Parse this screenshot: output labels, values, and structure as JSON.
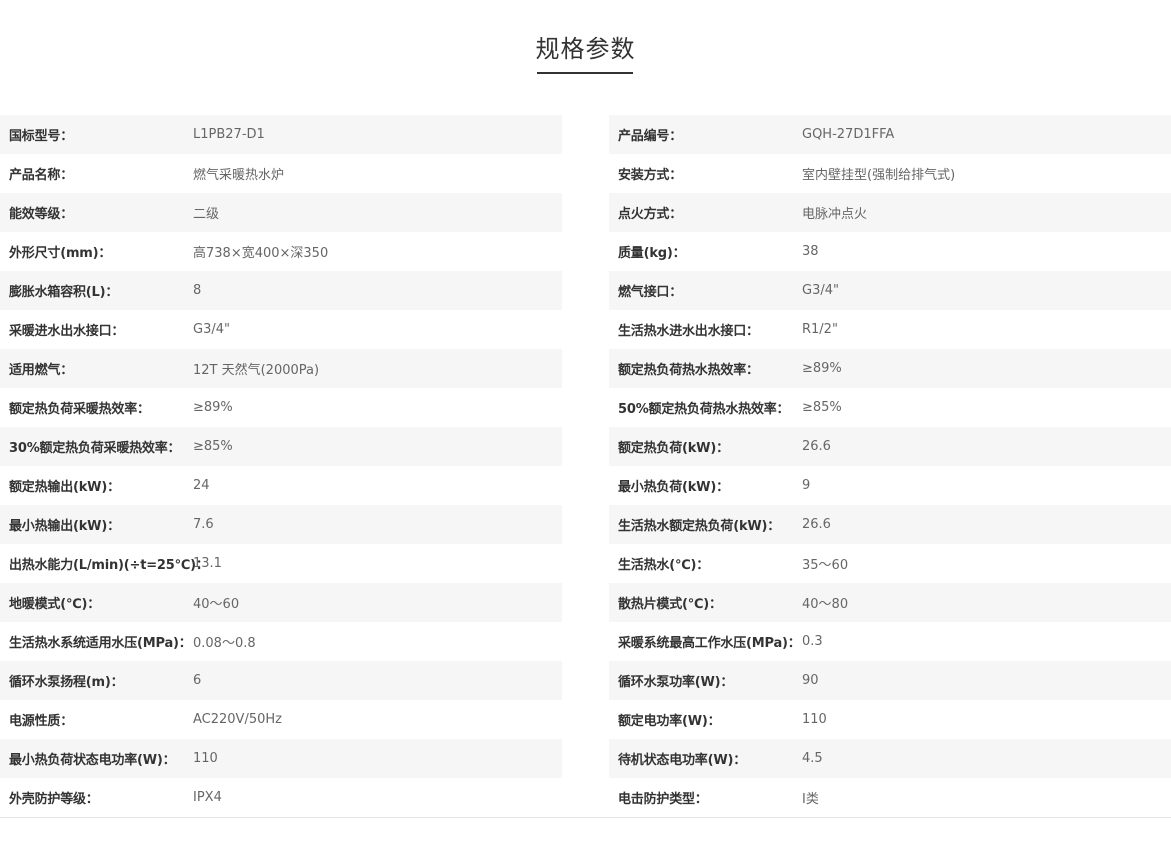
{
  "title": "规格参数",
  "left": [
    {
      "label": "国标型号：",
      "value": "L1PB27-D1"
    },
    {
      "label": "产品名称：",
      "value": "燃气采暖热水炉"
    },
    {
      "label": "能效等级：",
      "value": "二级"
    },
    {
      "label": "外形尺寸(mm)：",
      "value": "高738×宽400×深350"
    },
    {
      "label": "膨胀水箱容积(L)：",
      "value": "8"
    },
    {
      "label": "采暖进水出水接口：",
      "value": "G3/4\""
    },
    {
      "label": "适用燃气：",
      "value": "12T 天然气(2000Pa)"
    },
    {
      "label": "额定热负荷采暖热效率：",
      "value": "≥89%"
    },
    {
      "label": "30%额定热负荷采暖热效率：",
      "value": "≥85%"
    },
    {
      "label": "额定热输出(kW)：",
      "value": "24"
    },
    {
      "label": "最小热输出(kW)：",
      "value": "7.6"
    },
    {
      "label": "出热水能力(L/min)(÷t=25℃)：",
      "value": "13.1"
    },
    {
      "label": "地暖模式(℃)：",
      "value": "40～60"
    },
    {
      "label": "生活热水系统适用水压(MPa)：",
      "value": "0.08～0.8"
    },
    {
      "label": "循环水泵扬程(m)：",
      "value": "6"
    },
    {
      "label": "电源性质：",
      "value": "AC220V/50Hz"
    },
    {
      "label": "最小热负荷状态电功率(W)：",
      "value": "110"
    },
    {
      "label": "外壳防护等级：",
      "value": "IPX4"
    }
  ],
  "right": [
    {
      "label": "产品编号：",
      "value": "GQH-27D1FFA"
    },
    {
      "label": "安装方式：",
      "value": "室内壁挂型(强制给排气式)"
    },
    {
      "label": "点火方式：",
      "value": "电脉冲点火"
    },
    {
      "label": "质量(kg)：",
      "value": "38"
    },
    {
      "label": "燃气接口：",
      "value": "G3/4\""
    },
    {
      "label": "生活热水进水出水接口：",
      "value": "R1/2\""
    },
    {
      "label": "额定热负荷热水热效率：",
      "value": "≥89%"
    },
    {
      "label": "50%额定热负荷热水热效率：",
      "value": "≥85%"
    },
    {
      "label": "额定热负荷(kW)：",
      "value": "26.6"
    },
    {
      "label": "最小热负荷(kW)：",
      "value": "9"
    },
    {
      "label": "生活热水额定热负荷(kW)：",
      "value": "26.6"
    },
    {
      "label": "生活热水(℃)：",
      "value": "35～60"
    },
    {
      "label": "散热片模式(℃)：",
      "value": "40～80"
    },
    {
      "label": "采暖系统最高工作水压(MPa)：",
      "value": "0.3"
    },
    {
      "label": "循环水泵功率(W)：",
      "value": "90"
    },
    {
      "label": "额定电功率(W)：",
      "value": "110"
    },
    {
      "label": "待机状态电功率(W)：",
      "value": "4.5"
    },
    {
      "label": "电击防护类型：",
      "value": "I类"
    }
  ]
}
